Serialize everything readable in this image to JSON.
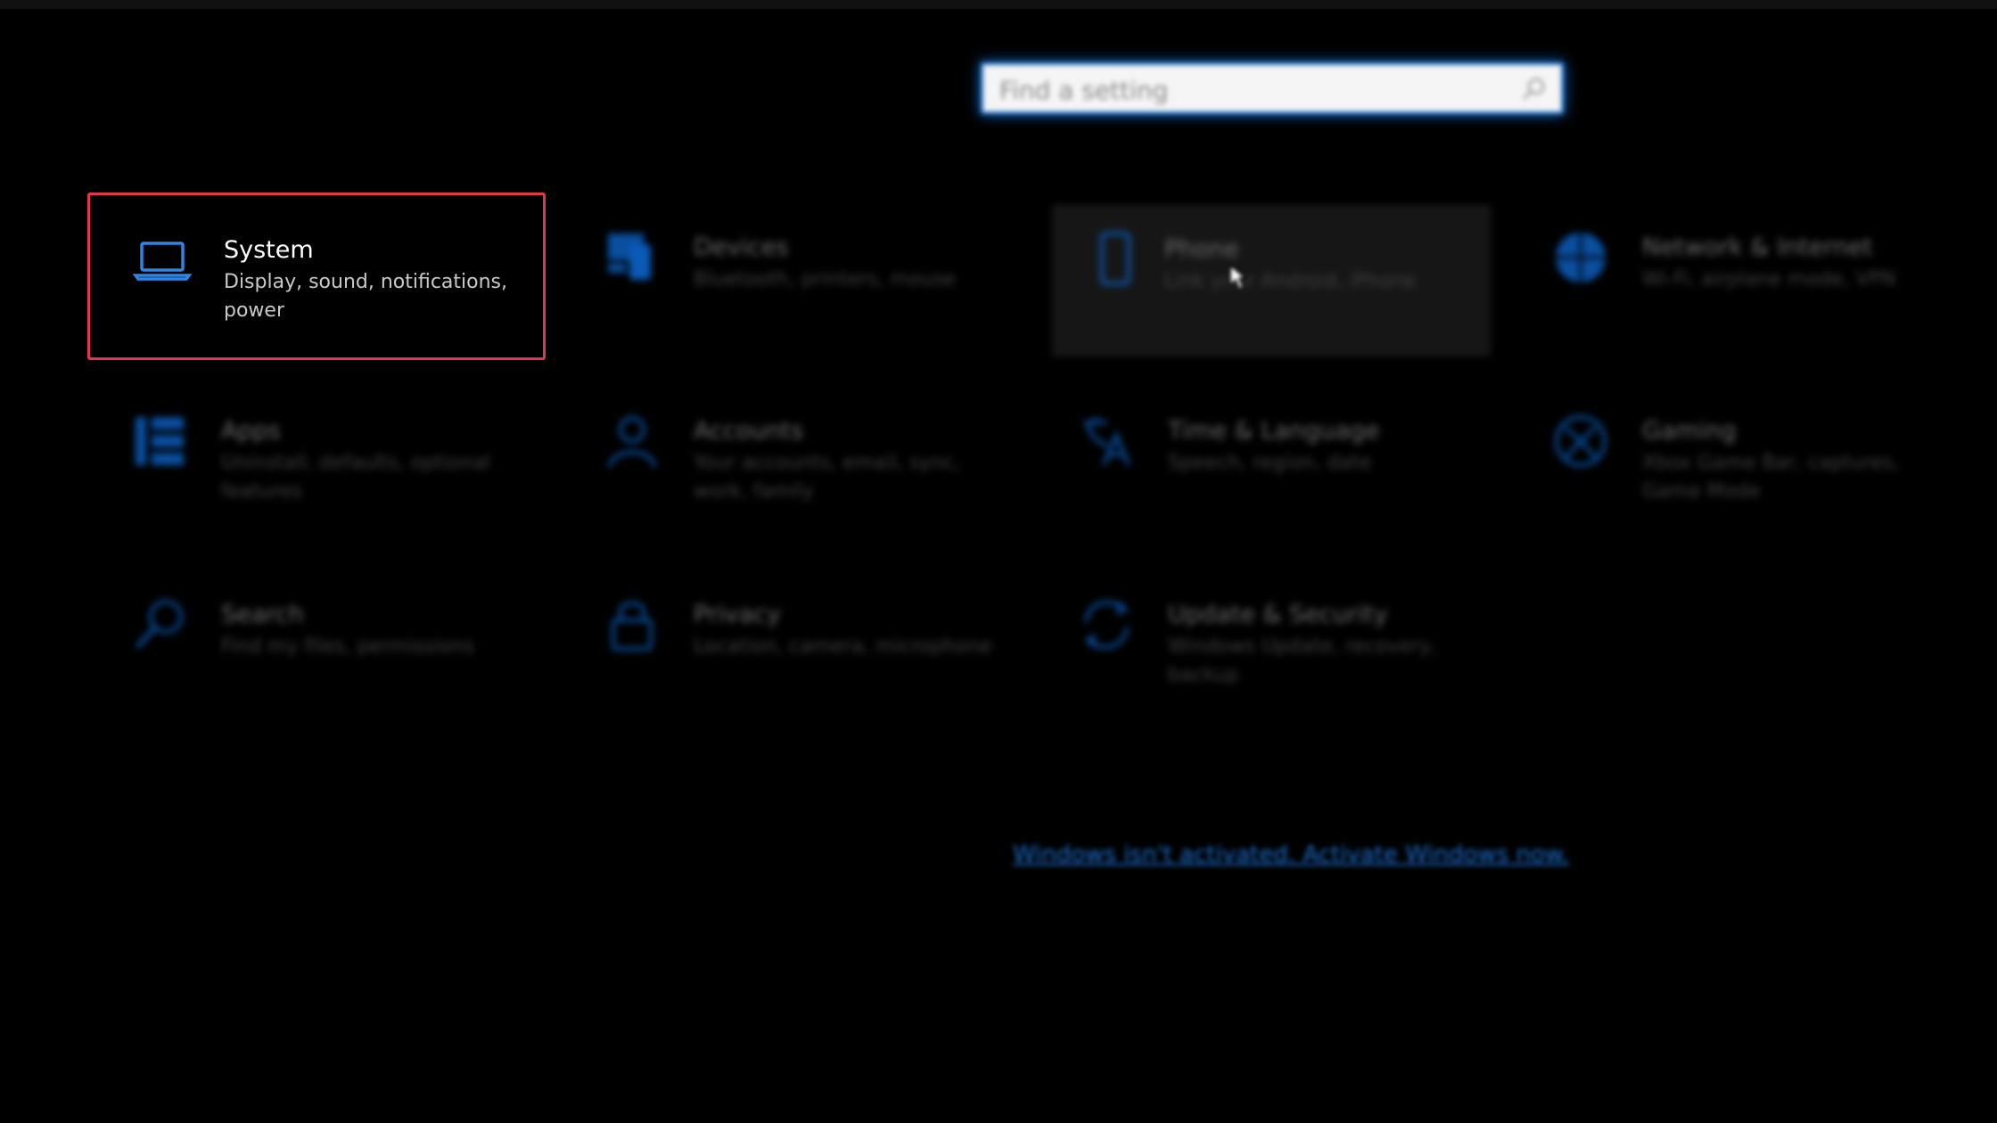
{
  "search": {
    "placeholder": "Find a setting"
  },
  "tiles": [
    {
      "label": "System",
      "desc": "Display, sound, notifications, power"
    },
    {
      "label": "Devices",
      "desc": "Bluetooth, printers, mouse"
    },
    {
      "label": "Phone",
      "desc": "Link your Android, iPhone"
    },
    {
      "label": "Network & Internet",
      "desc": "Wi-Fi, airplane mode, VPN"
    },
    {
      "label": "Apps",
      "desc": "Uninstall, defaults, optional features"
    },
    {
      "label": "Accounts",
      "desc": "Your accounts, email, sync, work, family"
    },
    {
      "label": "Time & Language",
      "desc": "Speech, region, date"
    },
    {
      "label": "Gaming",
      "desc": "Xbox Game Bar, captures, Game Mode"
    },
    {
      "label": "Search",
      "desc": "Find my files, permissions"
    },
    {
      "label": "Privacy",
      "desc": "Location, camera, microphone"
    },
    {
      "label": "Update & Security",
      "desc": "Windows Update, recovery, backup"
    }
  ],
  "footer": {
    "activate_link": "Windows isn't activated. Activate Windows now."
  },
  "colors": {
    "accent": "#0a6cd9",
    "selection_border": "#e2364a",
    "background": "#000000"
  },
  "icons": {
    "system": "laptop-icon",
    "devices": "devices-icon",
    "phone": "phone-icon",
    "network": "globe-icon",
    "apps": "apps-icon",
    "accounts": "person-icon",
    "time": "time-language-icon",
    "gaming": "xbox-icon",
    "search": "magnifier-icon",
    "privacy": "lock-icon",
    "update": "sync-icon"
  }
}
